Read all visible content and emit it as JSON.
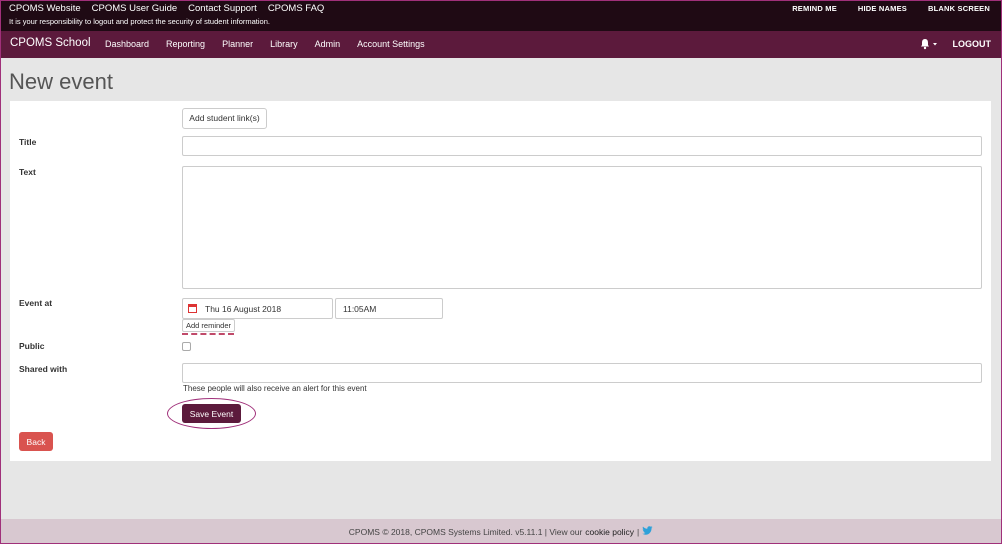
{
  "topbar": {
    "links": [
      "CPOMS Website",
      "CPOMS User Guide",
      "Contact Support",
      "CPOMS FAQ"
    ],
    "notice": "It is your responsibility to logout and protect the security of student information.",
    "actions": [
      "REMIND ME",
      "HIDE NAMES",
      "BLANK SCREEN"
    ]
  },
  "nav": {
    "brand": "CPOMS School",
    "items": [
      "Dashboard",
      "Reporting",
      "Planner",
      "Library",
      "Admin",
      "Account Settings"
    ],
    "logout": "LOGOUT",
    "bell_icon": "bell-icon"
  },
  "page": {
    "title": "New event"
  },
  "form": {
    "add_student_link": "Add student link(s)",
    "title_label": "Title",
    "title_value": "",
    "text_label": "Text",
    "text_value": "",
    "event_at_label": "Event at",
    "date_value": "Thu 16 August 2018",
    "time_value": "11:05AM",
    "add_reminder": "Add reminder",
    "public_label": "Public",
    "shared_with_label": "Shared with",
    "shared_with_value": "",
    "shared_help": "These people will also receive an alert for this event",
    "save_label": "Save Event",
    "back_label": "Back"
  },
  "footer": {
    "text_before": "CPOMS © 2018, CPOMS Systems Limited. v5.11.1 | View our",
    "cookie_link": "cookie policy",
    "separator": "|"
  },
  "colors": {
    "nav_bg": "#5c1a3c",
    "topbar_bg": "#1f0a14",
    "back_btn": "#d9534f",
    "accent_ring": "#a0307a"
  }
}
